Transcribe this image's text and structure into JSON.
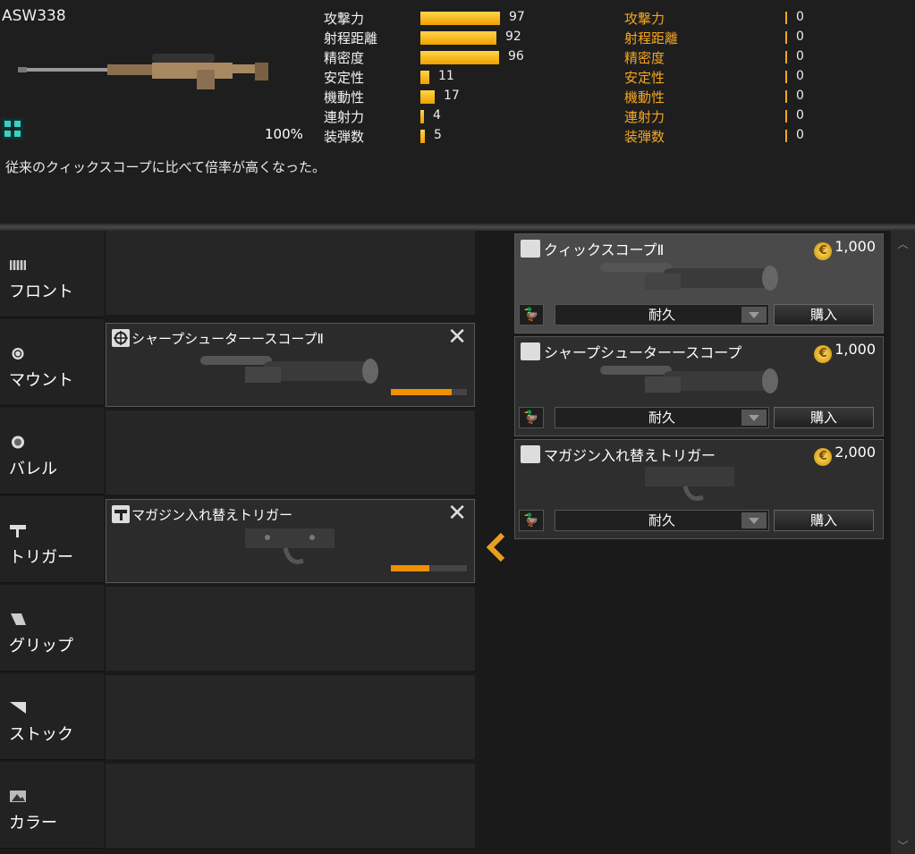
{
  "weapon": {
    "name": "ASW338",
    "mod_percent": "100%",
    "description": "従来のクィックスコープに比べて倍率が高くなった。"
  },
  "stats": [
    {
      "label": "攻撃力",
      "value": "97",
      "level": 97
    },
    {
      "label": "射程距離",
      "value": "92",
      "level": 92
    },
    {
      "label": "精密度",
      "value": "96",
      "level": 96
    },
    {
      "label": "安定性",
      "value": "11",
      "level": 11
    },
    {
      "label": "機動性",
      "value": "17",
      "level": 17
    },
    {
      "label": "連射力",
      "value": "4",
      "level": 4
    },
    {
      "label": "装弾数",
      "value": "5",
      "level": 5
    }
  ],
  "compare_stats": [
    {
      "label": "攻撃力",
      "value": "0"
    },
    {
      "label": "射程距離",
      "value": "0"
    },
    {
      "label": "精密度",
      "value": "0"
    },
    {
      "label": "安定性",
      "value": "0"
    },
    {
      "label": "機動性",
      "value": "0"
    },
    {
      "label": "連射力",
      "value": "0"
    },
    {
      "label": "装弾数",
      "value": "0"
    }
  ],
  "categories": [
    {
      "label": "フロント",
      "icon": "front-icon"
    },
    {
      "label": "マウント",
      "icon": "mount-icon"
    },
    {
      "label": "バレル",
      "icon": "barrel-icon"
    },
    {
      "label": "トリガー",
      "icon": "trigger-icon"
    },
    {
      "label": "グリップ",
      "icon": "grip-icon"
    },
    {
      "label": "ストック",
      "icon": "stock-icon"
    },
    {
      "label": "カラー",
      "icon": "color-icon"
    }
  ],
  "equipped": {
    "mount": {
      "name": "シャープシューターースコープⅡ",
      "durability": 0.8
    },
    "trigger": {
      "name": "マガジン入れ替えトリガー",
      "durability": 0.5
    }
  },
  "shop": [
    {
      "name": "クィックスコープⅡ",
      "price": "1,000",
      "durability_label": "耐久",
      "buy_label": "購入"
    },
    {
      "name": "シャープシューターースコープ",
      "price": "1,000",
      "durability_label": "耐久",
      "buy_label": "購入"
    },
    {
      "name": "マガジン入れ替えトリガー",
      "price": "2,000",
      "durability_label": "耐久",
      "buy_label": "購入"
    }
  ],
  "colors": {
    "accent": "#f5a623",
    "bar": "#f0a000"
  }
}
